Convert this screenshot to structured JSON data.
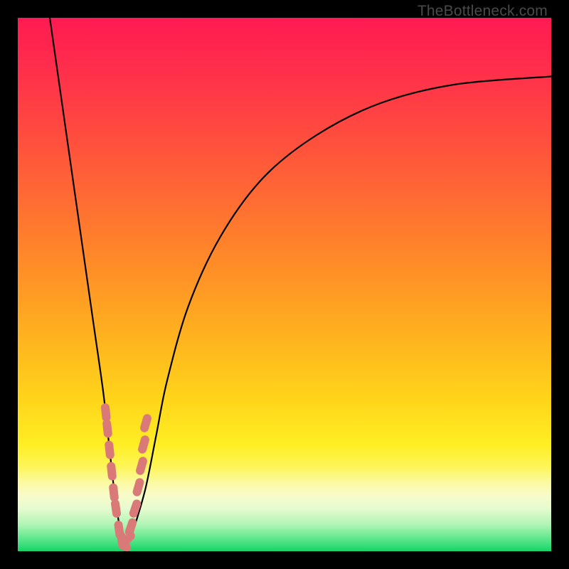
{
  "watermark": "TheBottleneck.com",
  "colors": {
    "black": "#000000",
    "curve": "#000000",
    "marker": "#d97a78",
    "gradient_stops": [
      {
        "offset": 0.0,
        "color": "#ff1a52"
      },
      {
        "offset": 0.1,
        "color": "#ff2f4b"
      },
      {
        "offset": 0.22,
        "color": "#ff4c3e"
      },
      {
        "offset": 0.35,
        "color": "#ff6e32"
      },
      {
        "offset": 0.48,
        "color": "#ff9126"
      },
      {
        "offset": 0.6,
        "color": "#ffb31e"
      },
      {
        "offset": 0.72,
        "color": "#ffd61a"
      },
      {
        "offset": 0.8,
        "color": "#ffee24"
      },
      {
        "offset": 0.84,
        "color": "#fdf555"
      },
      {
        "offset": 0.87,
        "color": "#fcfa9f"
      },
      {
        "offset": 0.895,
        "color": "#f8fbc9"
      },
      {
        "offset": 0.92,
        "color": "#e6fbcf"
      },
      {
        "offset": 0.95,
        "color": "#b0f5b5"
      },
      {
        "offset": 0.975,
        "color": "#63e88f"
      },
      {
        "offset": 1.0,
        "color": "#16d468"
      }
    ]
  },
  "chart_data": {
    "type": "line",
    "title": "",
    "xlabel": "",
    "ylabel": "",
    "xlim": [
      0,
      100
    ],
    "ylim": [
      0,
      100
    ],
    "grid": false,
    "legend": false,
    "series": [
      {
        "name": "bottleneck-curve",
        "x": [
          6,
          8,
          10,
          12,
          14,
          16,
          17,
          18,
          19,
          19.5,
          20,
          21,
          22,
          24,
          26,
          28,
          32,
          38,
          46,
          56,
          68,
          82,
          100
        ],
        "y": [
          100,
          86,
          72,
          58,
          44,
          30,
          21,
          12,
          5,
          2,
          1,
          2,
          5,
          12,
          22,
          32,
          46,
          59,
          70,
          78,
          84,
          87.5,
          89
        ]
      }
    ],
    "markers": {
      "name": "highlight-points",
      "x": [
        16.5,
        16.8,
        17.2,
        17.6,
        18.0,
        18.4,
        19.0,
        19.5,
        20.0,
        20.5,
        21.2,
        22.0,
        22.6,
        23.2,
        23.6,
        24.0
      ],
      "y": [
        26,
        23,
        19,
        15,
        11,
        8,
        4,
        2,
        1.5,
        2.2,
        4.5,
        8,
        12,
        16,
        20,
        24
      ]
    },
    "optimum_x": 20
  }
}
